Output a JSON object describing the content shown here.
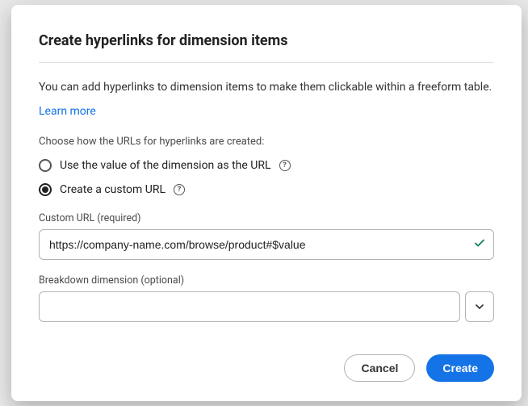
{
  "dialog": {
    "title": "Create hyperlinks for dimension items",
    "description": "You can add hyperlinks to dimension items to make them clickable within a freeform table.",
    "learn_more": "Learn more",
    "choose_label": "Choose how the URLs for hyperlinks are created:",
    "radio_options": {
      "use_value": {
        "label": "Use the value of the dimension as the URL",
        "selected": false
      },
      "custom_url": {
        "label": "Create a custom URL",
        "selected": true
      }
    },
    "custom_url_field": {
      "label": "Custom URL (required)",
      "value": "https://company-name.com/browse/product#$value",
      "valid": true
    },
    "breakdown_field": {
      "label": "Breakdown dimension (optional)",
      "value": ""
    },
    "buttons": {
      "cancel": "Cancel",
      "create": "Create"
    }
  }
}
